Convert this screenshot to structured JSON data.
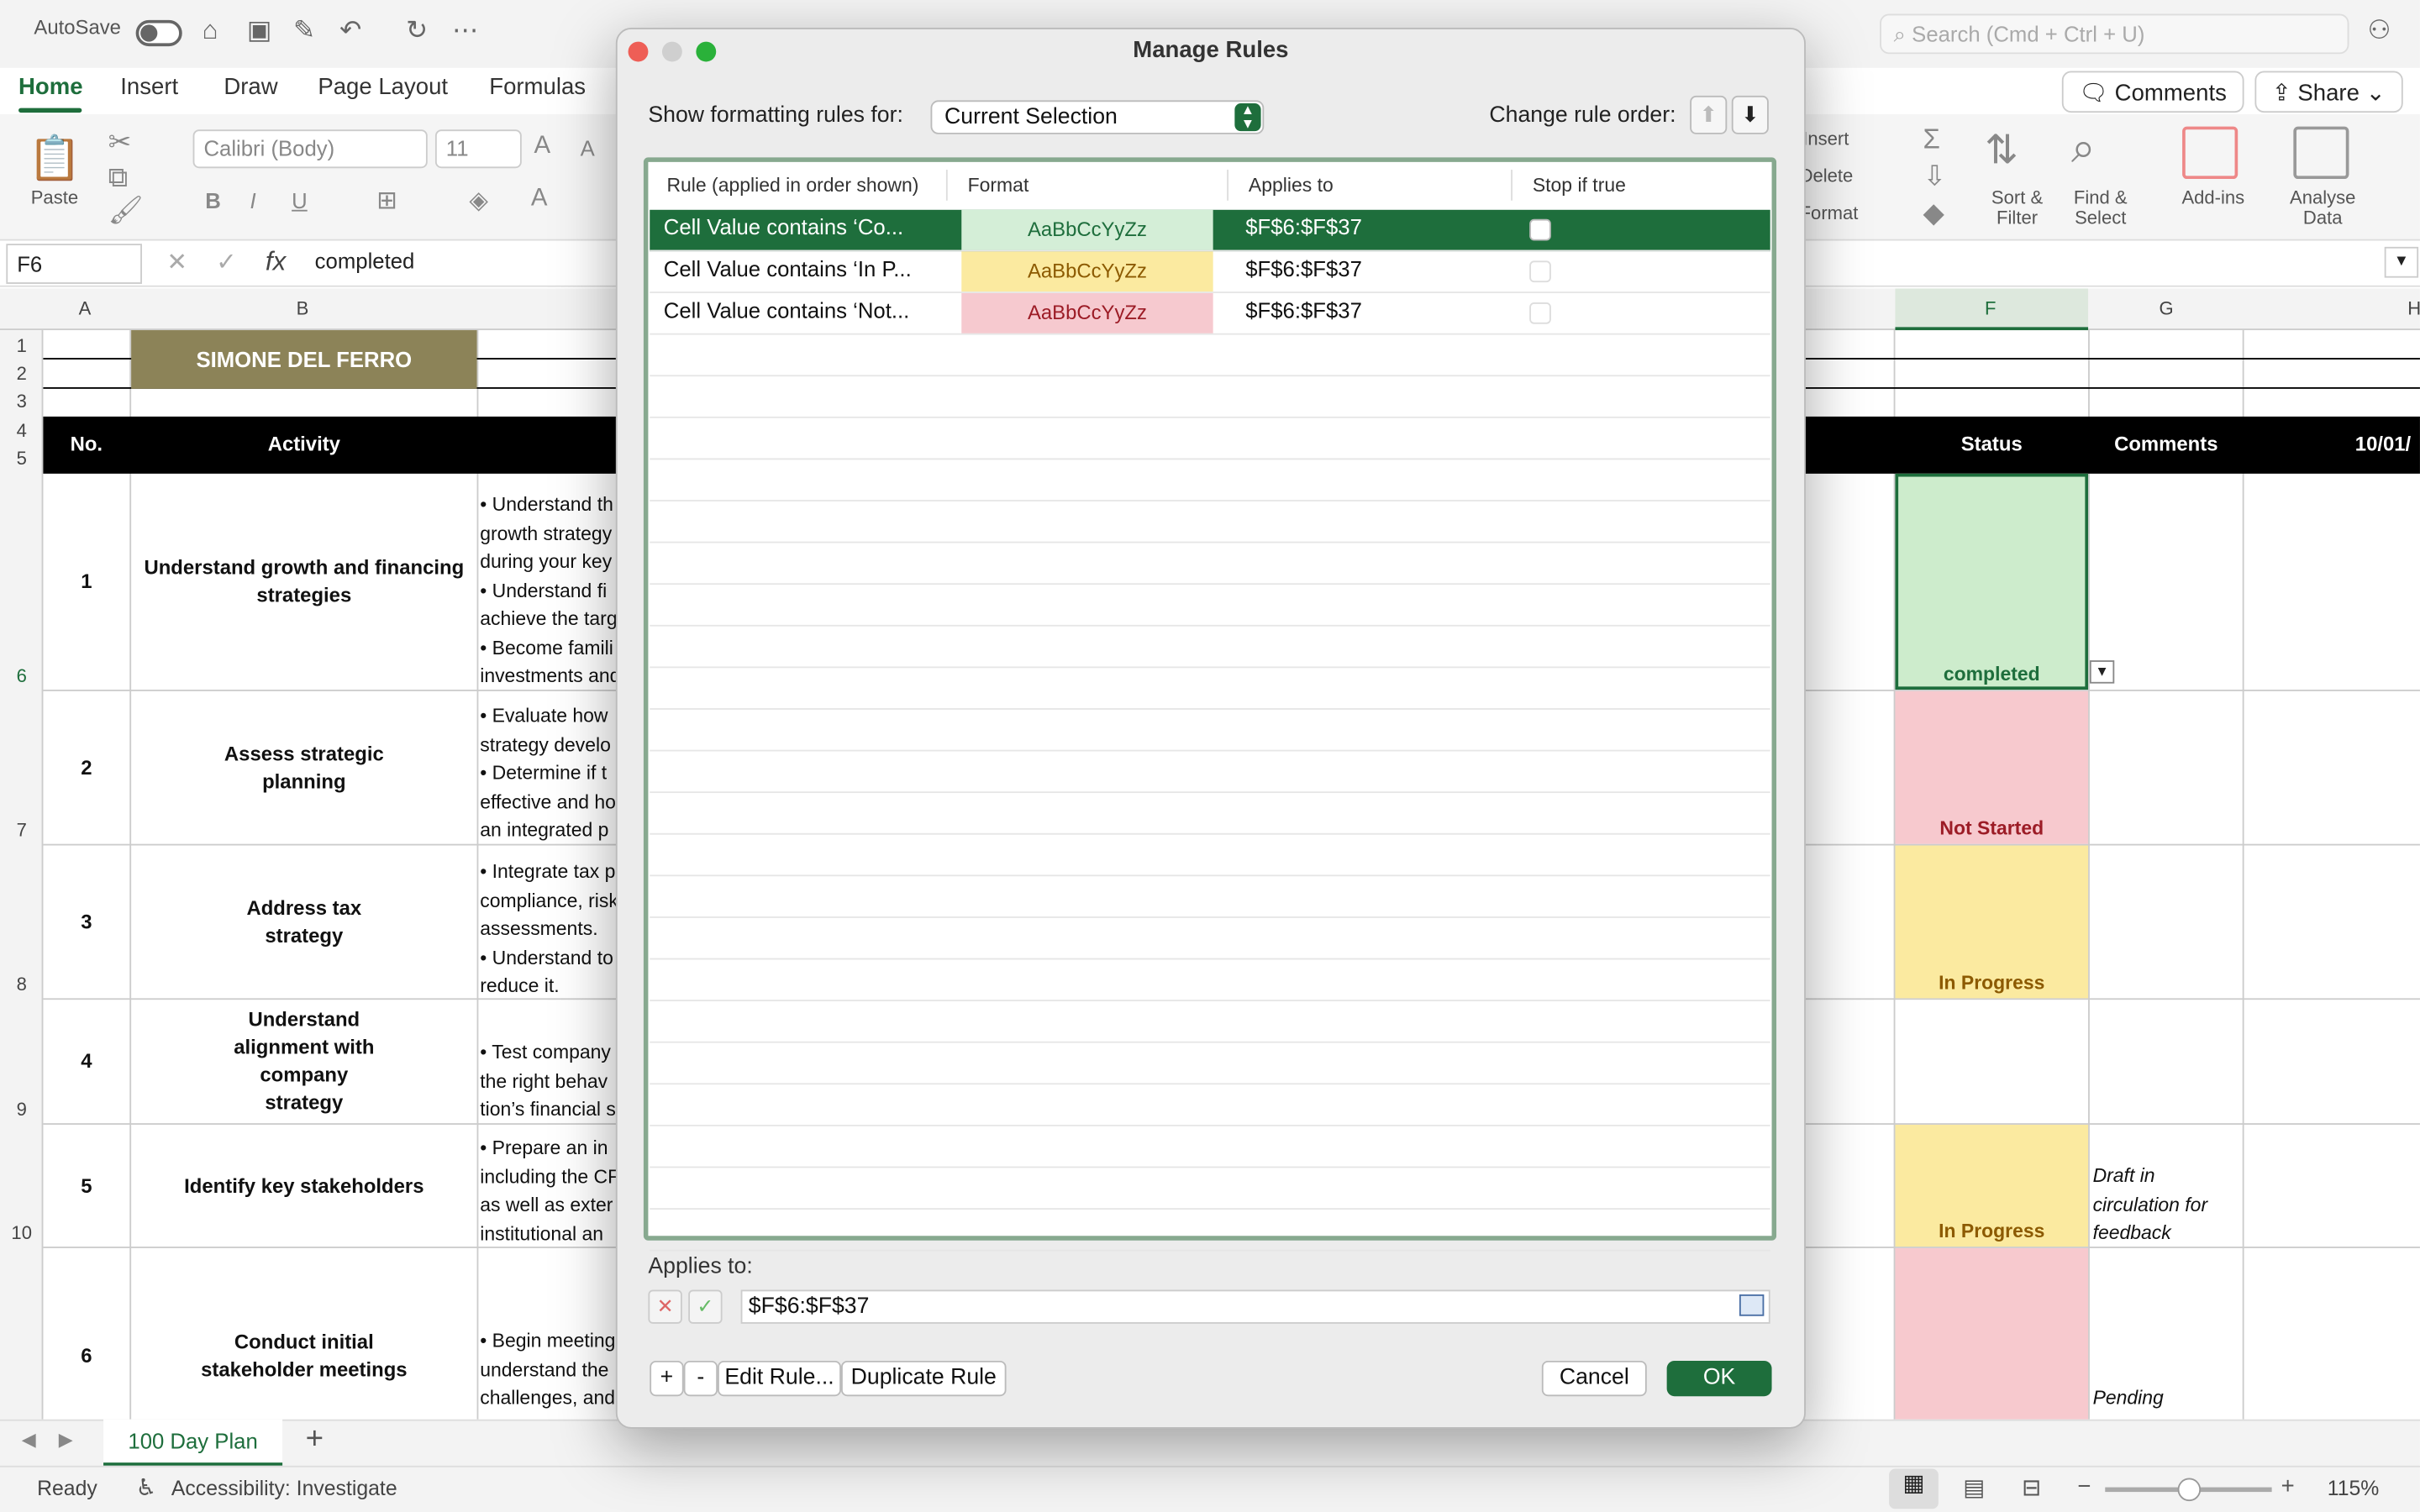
{
  "titlebar": {
    "autosave_label": "AutoSave",
    "search_placeholder": "Search (Cmd + Ctrl + U)"
  },
  "ribbon": {
    "tabs": [
      "Home",
      "Insert",
      "Draw",
      "Page Layout",
      "Formulas"
    ],
    "comments_label": "Comments",
    "share_label": "Share",
    "paste_label": "Paste",
    "font_name": "Calibri (Body)",
    "font_size": "11",
    "insert_label": "Insert",
    "delete_label": "Delete",
    "format_label": "Format",
    "sort_label": "Sort & Filter",
    "find_label": "Find & Select",
    "addins_label": "Add-ins",
    "analyse_label": "Analyse Data"
  },
  "formula_bar": {
    "cell_ref": "F6",
    "value": "completed"
  },
  "sheet": {
    "columns": [
      "A",
      "B",
      "F",
      "G",
      "H"
    ],
    "rows": [
      "1",
      "2",
      "3",
      "4",
      "5",
      "6",
      "7",
      "8",
      "9",
      "10"
    ],
    "title": "SIMONE DEL FERRO",
    "headers": {
      "no": "No.",
      "activity": "Activity",
      "status": "Status",
      "comments": "Comments",
      "date": "10/01/"
    },
    "entries": [
      {
        "no": "1",
        "activity": "Understand growth and financing strategies",
        "desc": [
          "• Understand th",
          "growth strategy",
          "during your key",
          "• Understand fi",
          "achieve the targ",
          "• Become famili",
          "investments and"
        ],
        "status": "completed",
        "comment": ""
      },
      {
        "no": "2",
        "activity": "Assess strategic planning",
        "desc": [
          "• Evaluate how",
          "strategy develo",
          "• Determine if t",
          "effective and ho",
          "an integrated p"
        ],
        "status": "Not Started",
        "comment": ""
      },
      {
        "no": "3",
        "activity": "Address tax strategy",
        "desc": [
          "• Integrate tax p",
          "compliance, risk",
          "assessments.",
          "• Understand to",
          "reduce it."
        ],
        "status": "In Progress",
        "comment": ""
      },
      {
        "no": "4",
        "activity": "Understand alignment with company strategy",
        "desc": [
          "• Test company",
          "the right behav",
          "tion’s financial s"
        ],
        "status": "",
        "comment": ""
      },
      {
        "no": "5",
        "activity": "Identify key stakeholders",
        "desc": [
          "• Prepare an in",
          "including the CF",
          "as well as exter",
          "institutional an"
        ],
        "status": "In Progress",
        "comment": "Draft in circulation for feedback"
      },
      {
        "no": "6",
        "activity": "Conduct initial stakeholder meetings",
        "desc": [
          "• Begin meeting",
          "understand the",
          "challenges, and"
        ],
        "status": "",
        "comment": "Pending"
      }
    ],
    "sheet_tab": "100 Day Plan"
  },
  "statusbar": {
    "ready": "Ready",
    "accessibility": "Accessibility: Investigate",
    "zoom": "115%"
  },
  "dialog": {
    "title": "Manage Rules",
    "show_label": "Show formatting rules for:",
    "scope": "Current Selection",
    "order_label": "Change rule order:",
    "columns": [
      "Rule (applied in order shown)",
      "Format",
      "Applies to",
      "Stop if true"
    ],
    "rules": [
      {
        "rule": "Cell Value contains ‘Co...",
        "format": "AaBbCcYyZz",
        "applies": "$F$6:$F$37",
        "bg": "#d4eed7",
        "fg": "#1e6e3c"
      },
      {
        "rule": "Cell Value contains ‘In P...",
        "format": "AaBbCcYyZz",
        "applies": "$F$6:$F$37",
        "bg": "#fbeaa0",
        "fg": "#8c5a00"
      },
      {
        "rule": "Cell Value contains ‘Not...",
        "format": "AaBbCcYyZz",
        "applies": "$F$6:$F$37",
        "bg": "#f6c9cf",
        "fg": "#9c1c26"
      }
    ],
    "applies_to_label": "Applies to:",
    "applies_to_value": "$F$6:$F$37",
    "buttons": {
      "add": "+",
      "remove": "-",
      "edit": "Edit Rule...",
      "duplicate": "Duplicate Rule",
      "cancel": "Cancel",
      "ok": "OK"
    }
  }
}
